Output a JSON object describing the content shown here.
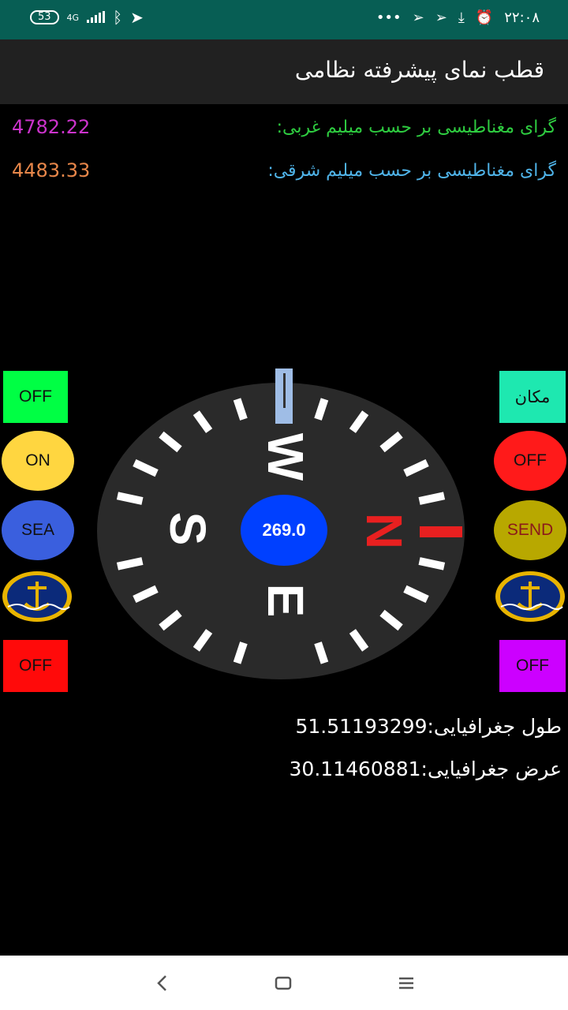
{
  "status_bar": {
    "battery": "53",
    "network": "4G",
    "time": "۲۲:۰۸",
    "dots": "•••",
    "icons": [
      "battery-icon",
      "signal-icon",
      "bluetooth-icon",
      "location-arrow-icon",
      "telegram-icon",
      "telegram-icon",
      "download-icon",
      "alarm-icon"
    ]
  },
  "app": {
    "title": "قطب نمای پیشرفته نظامی"
  },
  "readings": {
    "west_label": "گرای مغناطیسی بر حسب میلیم غربی:",
    "west_value": "4782.22",
    "east_label": "گرای مغناطیسی بر حسب میلیم شرقی:",
    "east_value": "4483.33"
  },
  "left_buttons": {
    "off_green": "OFF",
    "on": "ON",
    "sea": "SEA",
    "off_red": "OFF"
  },
  "right_buttons": {
    "location": "مکان",
    "off_red": "OFF",
    "send": "SEND",
    "off_purple": "OFF"
  },
  "compass": {
    "heading": "269.0",
    "dir_n": "N",
    "dir_e": "E",
    "dir_s": "S",
    "dir_w": "W"
  },
  "coordinates": {
    "longitude": "طول جغرافیایی:51.51193299",
    "latitude": "عرض جغرافیایی:30.11460881"
  },
  "colors": {
    "status_bar": "#075e54",
    "app_bar": "#212121",
    "west_label": "#2ecc40",
    "west_value": "#cc33cc",
    "east_label": "#4fb3e8",
    "east_value": "#e8874a",
    "north": "#e82020"
  }
}
